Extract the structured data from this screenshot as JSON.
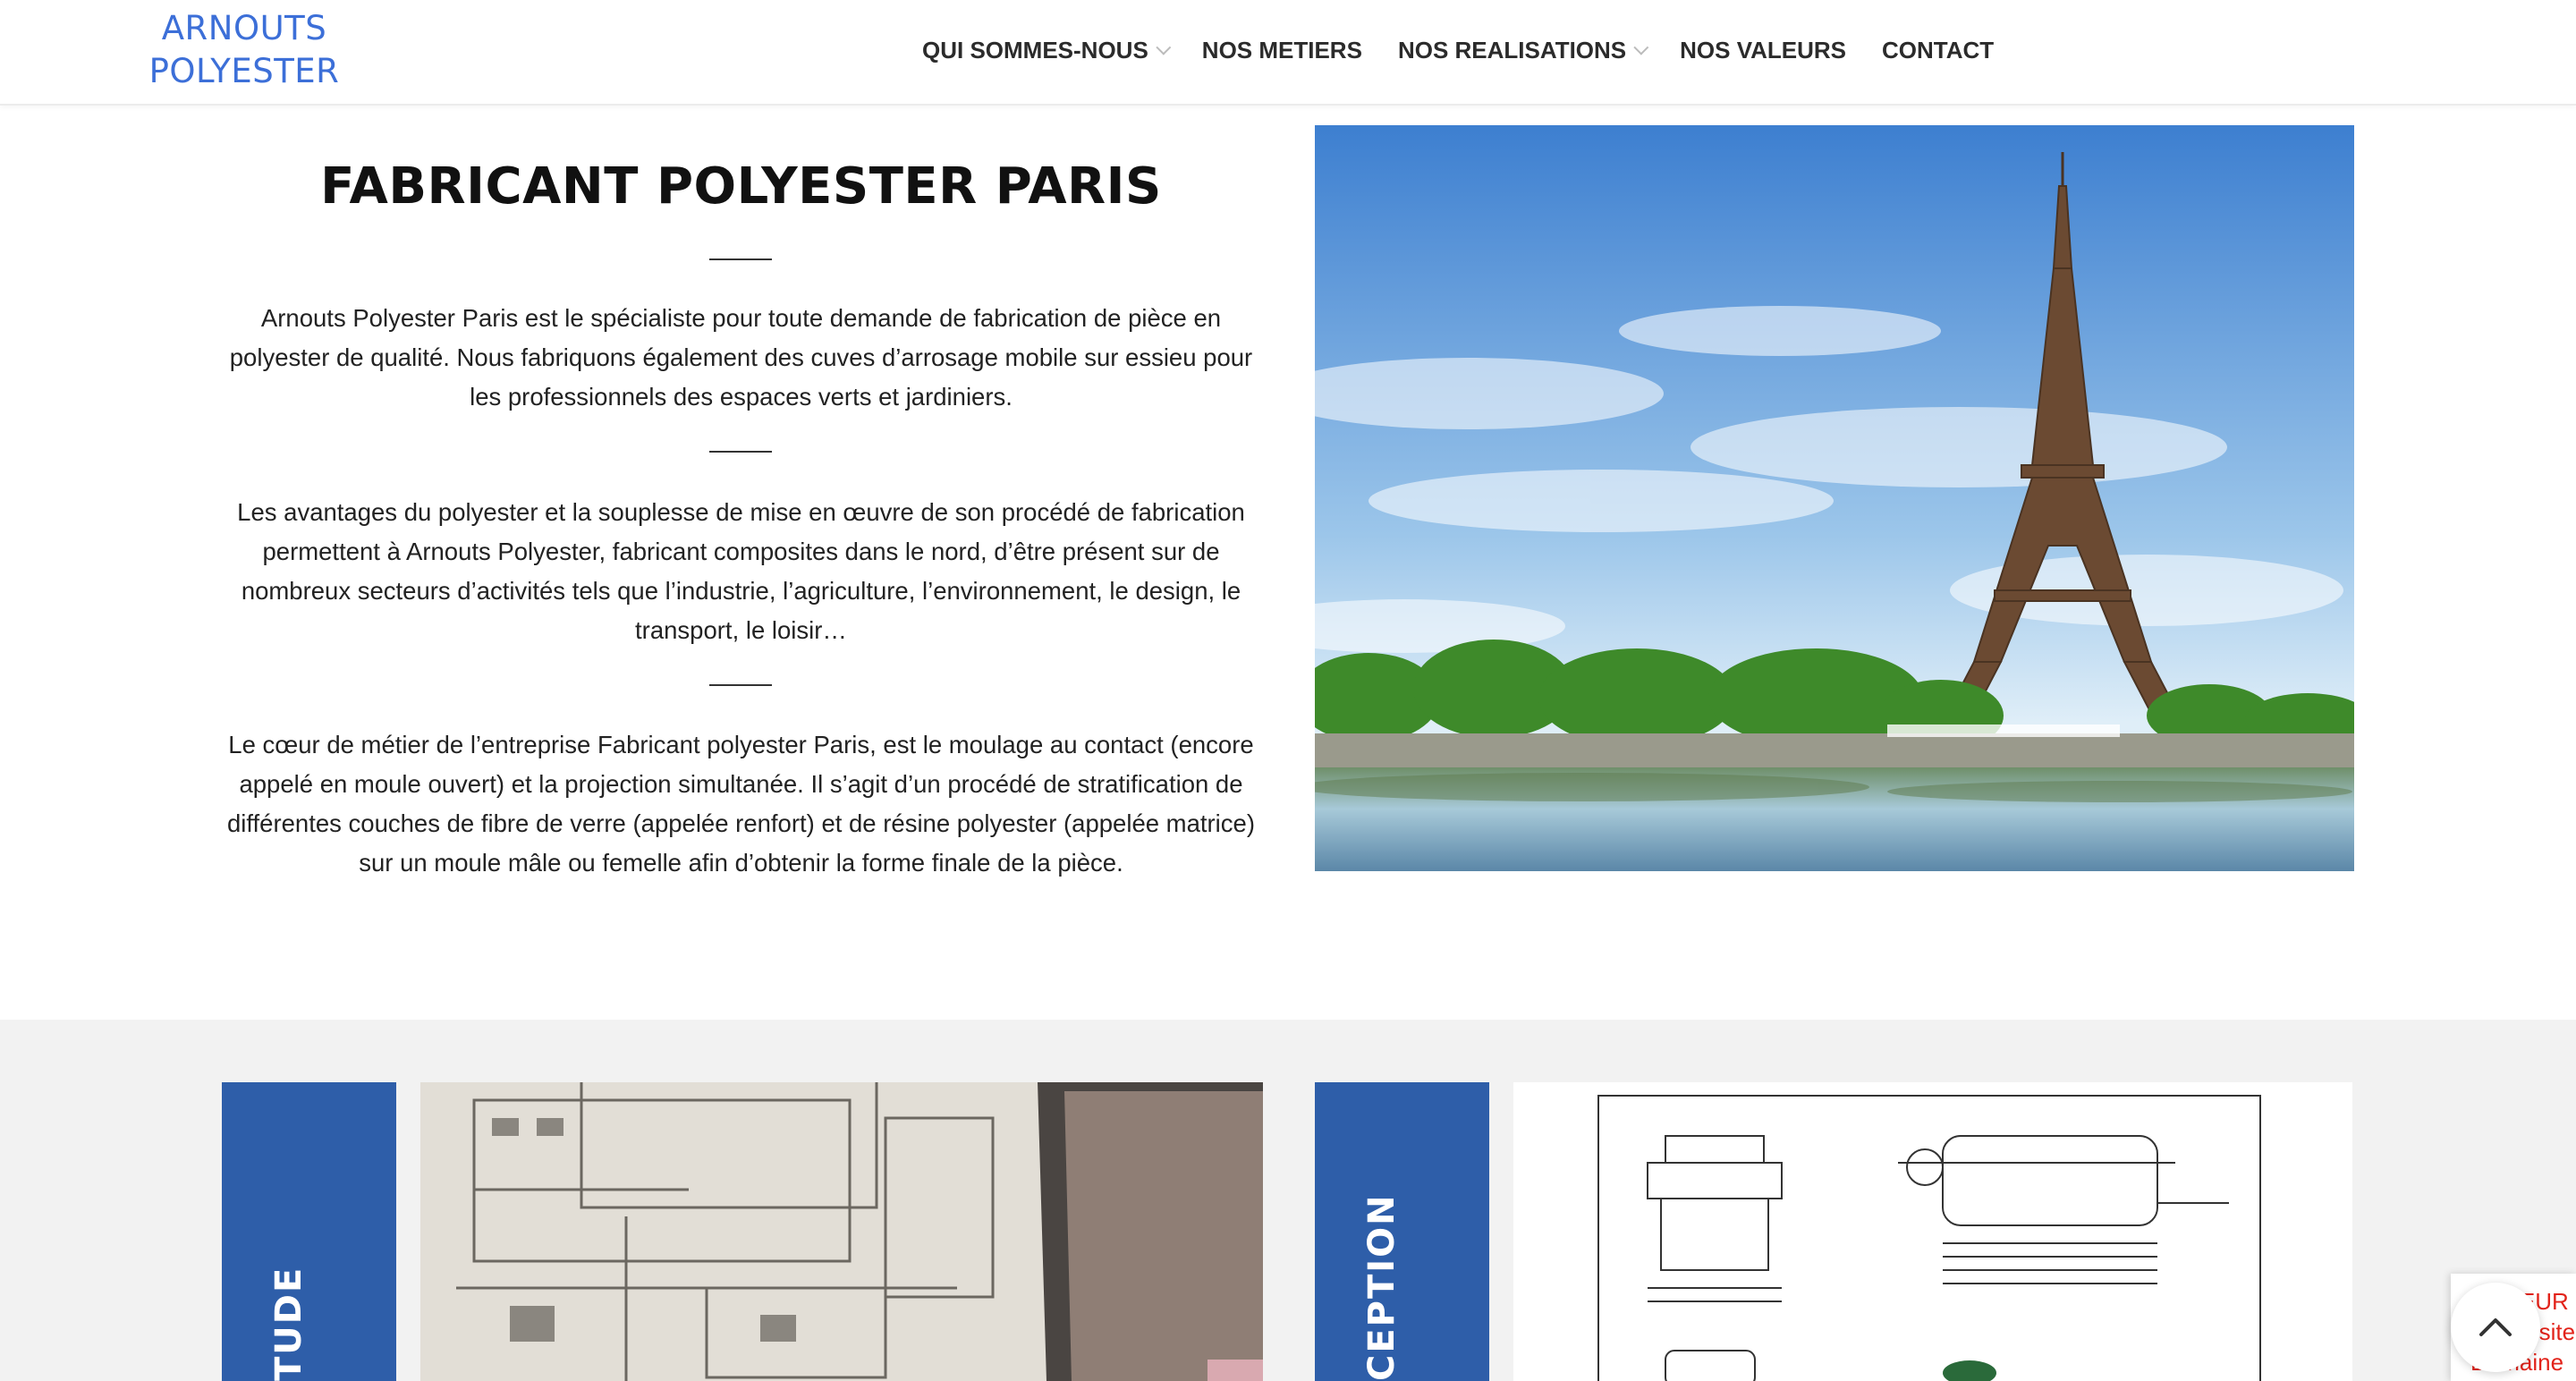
{
  "brand": {
    "logo_line1": "ARNOUTS",
    "logo_line2": "POLYESTER",
    "color": "#3c6fd8"
  },
  "nav": {
    "items": [
      {
        "label": "QUI SOMMES-NOUS",
        "has_dropdown": true
      },
      {
        "label": "NOS METIERS",
        "has_dropdown": false
      },
      {
        "label": "NOS REALISATIONS",
        "has_dropdown": true
      },
      {
        "label": "NOS VALEURS",
        "has_dropdown": false
      },
      {
        "label": "CONTACT",
        "has_dropdown": false
      }
    ]
  },
  "intro": {
    "title": "FABRICANT POLYESTER PARIS",
    "para1": [
      "Arnouts Polyester Paris est le spécialiste pour toute demande de fabrication de pièce en",
      "polyester de qualité. Nous fabriquons également des cuves d’arrosage mobile sur essieu pour",
      "les professionnels des espaces verts et jardiniers."
    ],
    "para2": [
      "Les avantages du polyester et la souplesse de mise en œuvre de son procédé de fabrication",
      "permettent à Arnouts Polyester, fabricant composites dans le nord, d’être présent sur de",
      "nombreux secteurs d’activités tels que l’industrie, l’agriculture, l’environnement, le design, le",
      "transport, le loisir…"
    ],
    "para3": [
      "Le cœur de métier de l’entreprise Fabricant polyester Paris, est le moulage au contact (encore",
      "appelé en moule ouvert) et la projection simultanée. Il s’agit d’un procédé de stratification de",
      "différentes couches de fibre de verre (appelée renfort) et de résine polyester (appelée matrice)",
      "sur un moule mâle ou femelle afin d’obtenir la forme finale de la pièce."
    ]
  },
  "cards": [
    {
      "label": "TUDE",
      "color": "#2e5ea9"
    },
    {
      "label": "CEPTION",
      "color": "#2e5ea9"
    }
  ],
  "widgets": {
    "recaptcha_error": [
      "ERREUR p",
      "clé du site :",
      "Domaine"
    ]
  },
  "colors": {
    "accent_blue": "#2e5ea9",
    "band_bg": "#f2f2f2",
    "error_red": "#e2231a"
  }
}
